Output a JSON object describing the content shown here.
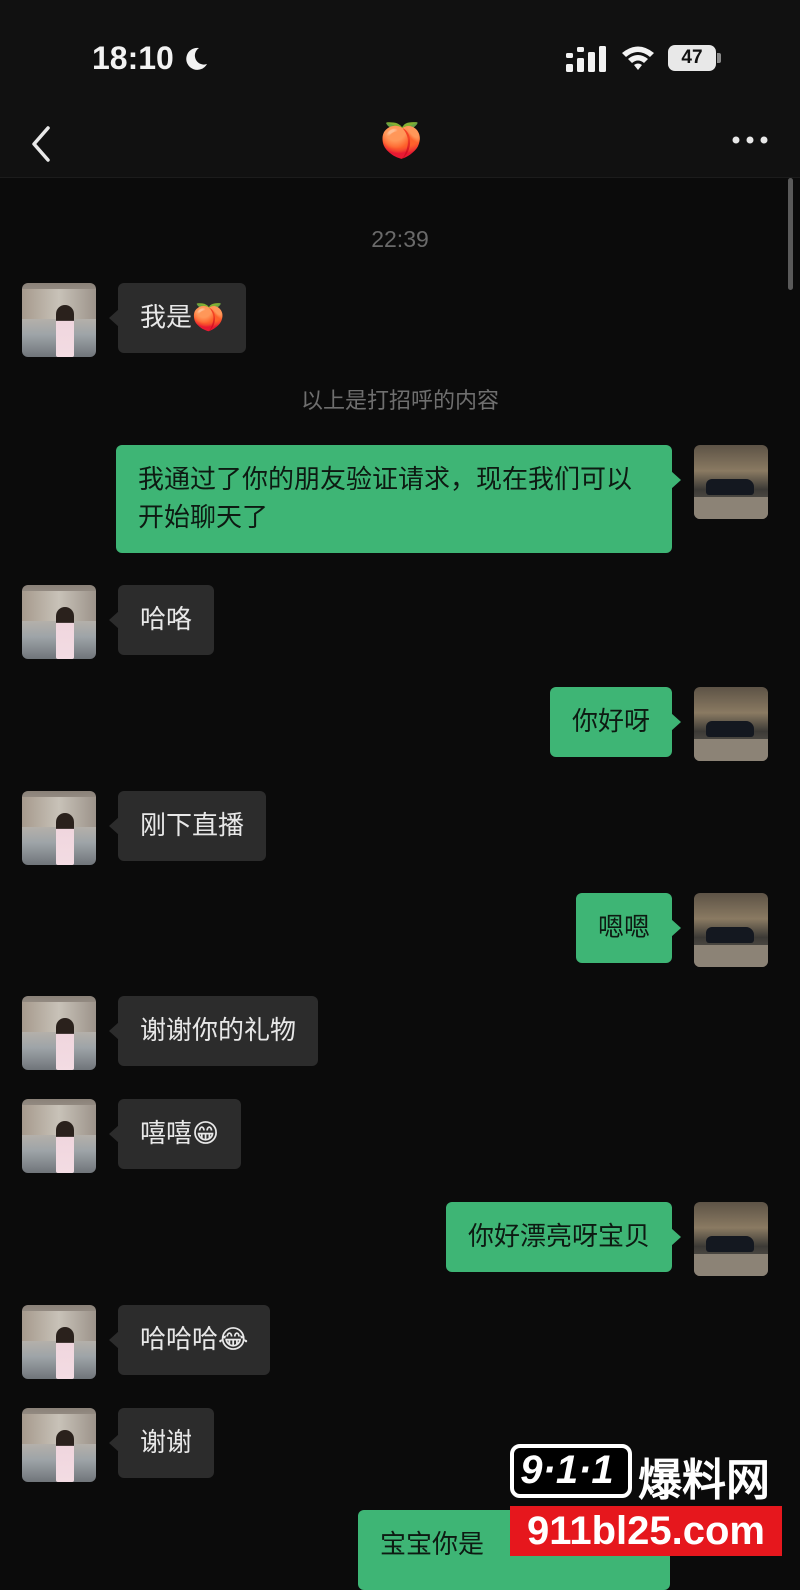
{
  "status_bar": {
    "time": "18:10",
    "battery_level": "47",
    "icons": [
      "moon-icon",
      "signal-icon",
      "wifi-icon",
      "battery-icon"
    ]
  },
  "nav": {
    "back_icon": "chevron-left-icon",
    "title": "🍑",
    "more_icon": "more-horizontal-icon"
  },
  "chat": {
    "time_separator": "22:39",
    "system_note": "以上是打招呼的内容",
    "messages": [
      {
        "side": "in",
        "text": "我是🍑"
      },
      {
        "side": "out",
        "text": "我通过了你的朋友验证请求，现在我们可以开始聊天了"
      },
      {
        "side": "in",
        "text": "哈咯"
      },
      {
        "side": "out",
        "text": "你好呀"
      },
      {
        "side": "in",
        "text": "刚下直播"
      },
      {
        "side": "out",
        "text": "嗯嗯"
      },
      {
        "side": "in",
        "text": "谢谢你的礼物"
      },
      {
        "side": "in",
        "text": "嘻嘻😁"
      },
      {
        "side": "out",
        "text": "你好漂亮呀宝贝"
      },
      {
        "side": "in",
        "text": "哈哈哈😂"
      },
      {
        "side": "in",
        "text": "谢谢"
      },
      {
        "side": "out",
        "text": "宝宝你是"
      }
    ]
  },
  "watermark": {
    "logo_number": "9·1·1",
    "logo_text": "爆料网",
    "url": "911bl25.com"
  },
  "colors": {
    "background": "#0b0b0b",
    "incoming_bubble": "#2c2c2c",
    "outgoing_bubble": "#3eb575",
    "watermark_red": "#e6171d"
  }
}
